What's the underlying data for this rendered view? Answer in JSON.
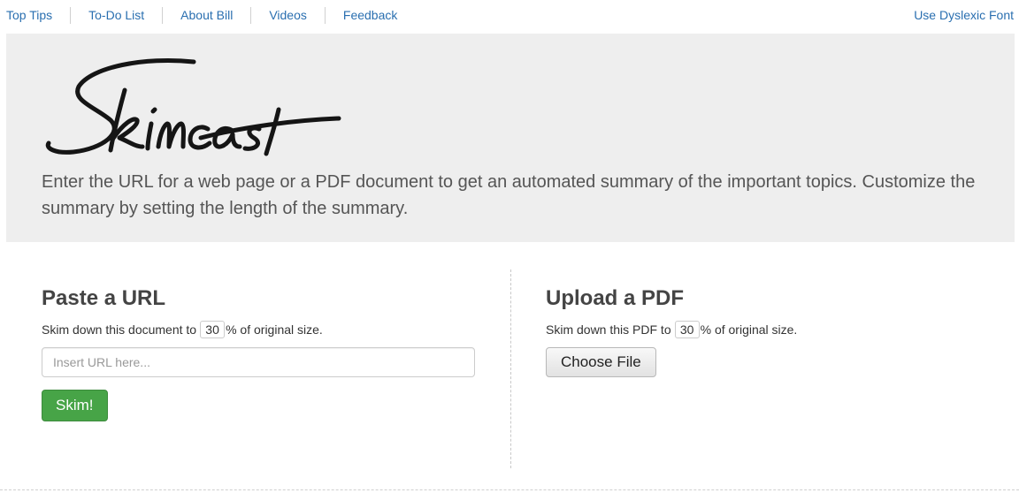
{
  "nav": {
    "links": [
      "Top Tips",
      "To-Do List",
      "About Bill",
      "Videos",
      "Feedback"
    ],
    "dyslexic_font": "Use Dyslexic Font"
  },
  "hero": {
    "logo_text": "Skimcast",
    "intro": "Enter the URL for a web page or a PDF document to get an automated summary of the important topics. Customize the summary by setting the length of the summary."
  },
  "url_section": {
    "title": "Paste a URL",
    "skim_prefix": "Skim down this document to",
    "percent_value": "30",
    "skim_suffix": "% of original size.",
    "url_placeholder": "Insert URL here...",
    "skim_button": "Skim!"
  },
  "pdf_section": {
    "title": "Upload a PDF",
    "skim_prefix": "Skim down this PDF to",
    "percent_value": "30",
    "skim_suffix": "% of original size.",
    "choose_button": "Choose File"
  },
  "colors": {
    "link": "#2a6fb0",
    "hero_bg": "#eeeeee",
    "skim_button": "#47a447"
  }
}
